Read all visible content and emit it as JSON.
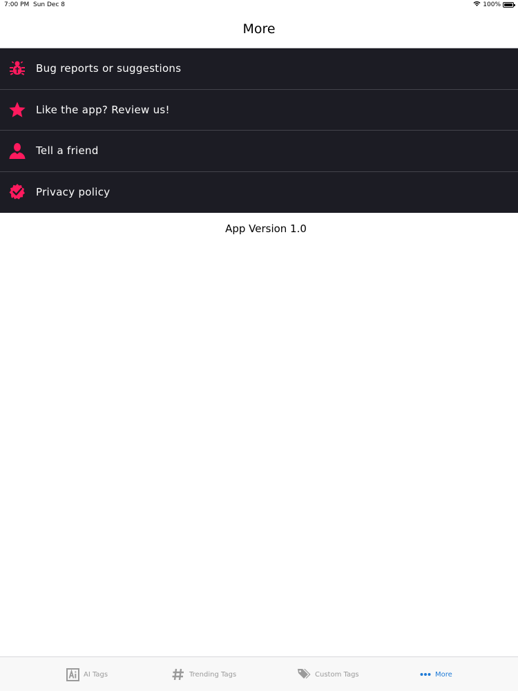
{
  "status_bar": {
    "time": "7:00 PM",
    "date": "Sun Dec 8",
    "battery": "100%"
  },
  "nav": {
    "title": "More"
  },
  "menu": {
    "items": [
      {
        "label": "Bug reports or suggestions",
        "icon": "bug-icon"
      },
      {
        "label": "Like the app? Review us!",
        "icon": "star-icon"
      },
      {
        "label": "Tell a friend",
        "icon": "person-icon"
      },
      {
        "label": "Privacy policy",
        "icon": "shield-check-icon"
      }
    ]
  },
  "version": {
    "text": "App Version 1.0"
  },
  "tab_bar": {
    "tabs": [
      {
        "label": "AI Tags",
        "icon": "ai-icon",
        "active": false
      },
      {
        "label": "Trending Tags",
        "icon": "hashtag-icon",
        "active": false
      },
      {
        "label": "Custom Tags",
        "icon": "tags-icon",
        "active": false
      },
      {
        "label": "More",
        "icon": "more-dots-icon",
        "active": true
      }
    ]
  },
  "colors": {
    "accent": "#ff1a5e",
    "menu_background": "#1c1c24",
    "tab_active": "#1e7ad6",
    "tab_inactive": "#9a9a9a"
  }
}
